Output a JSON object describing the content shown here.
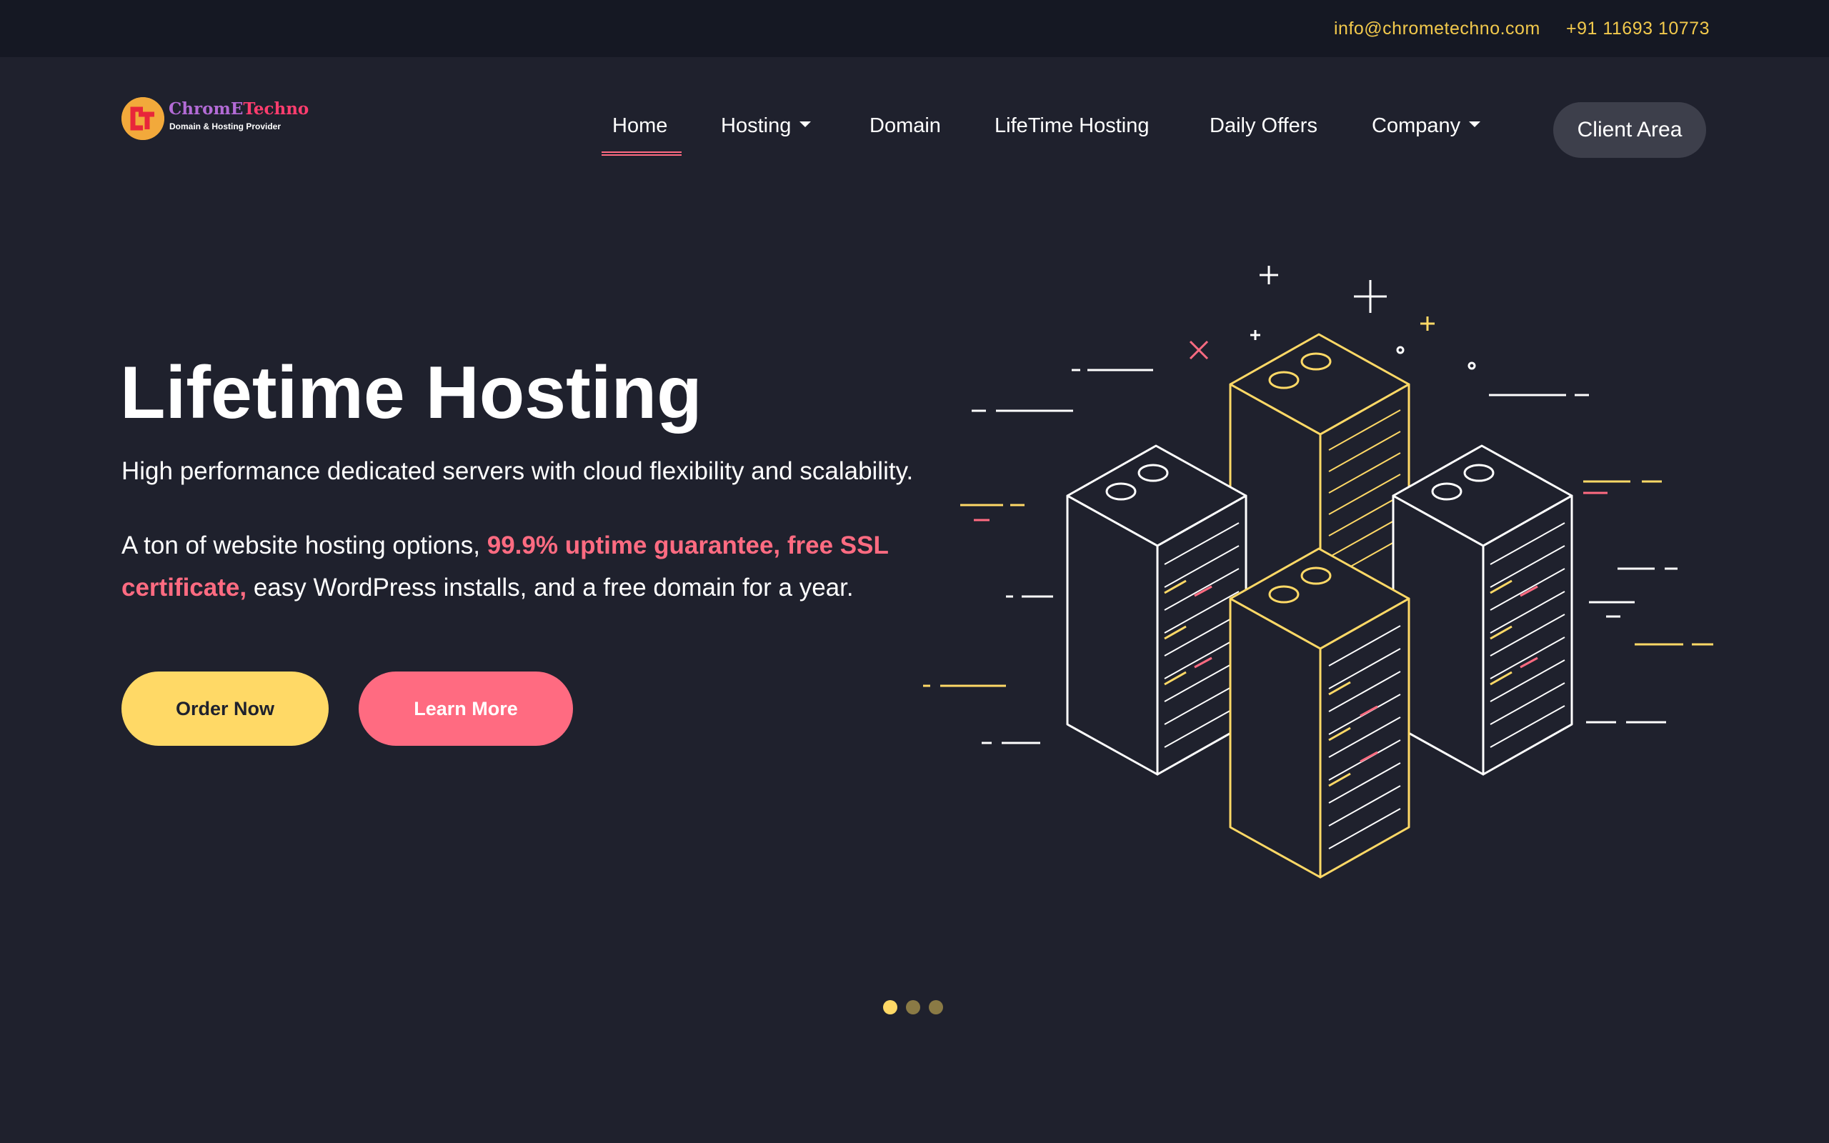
{
  "topbar": {
    "email": "info@chrometechno.com",
    "phone": "+91 11693 10773"
  },
  "logo": {
    "title_part1": "ChromE",
    "title_part2": "Techno",
    "tagline": "Domain & Hosting Provider"
  },
  "nav": {
    "items": [
      {
        "label": "Home",
        "active": true
      },
      {
        "label": "Hosting",
        "dropdown": true
      },
      {
        "label": "Domain"
      },
      {
        "label": "LifeTime Hosting"
      },
      {
        "label": "Daily Offers"
      },
      {
        "label": "Company",
        "dropdown": true
      }
    ],
    "client_area": "Client Area"
  },
  "hero": {
    "title": "Lifetime Hosting",
    "subtitle": "High performance dedicated servers with cloud flexibility and scalability.",
    "desc_before": "A ton of website hosting options, ",
    "desc_highlight": "99.9% uptime guarantee, free SSL certificate,",
    "desc_after": " easy WordPress installs, and a free domain for a year.",
    "order_button": "Order Now",
    "learn_button": "Learn More"
  },
  "carousel": {
    "slides": 3,
    "active_index": 0
  },
  "colors": {
    "background": "#1f212d",
    "topbar": "#151823",
    "accent_yellow": "#ffd966",
    "accent_pink": "#ff6b81",
    "contact_text": "#f2c94c",
    "client_button": "#3d3f4b"
  },
  "icons": [
    "logo-mark-icon",
    "chevron-down-icon",
    "server-rack-illustration"
  ]
}
